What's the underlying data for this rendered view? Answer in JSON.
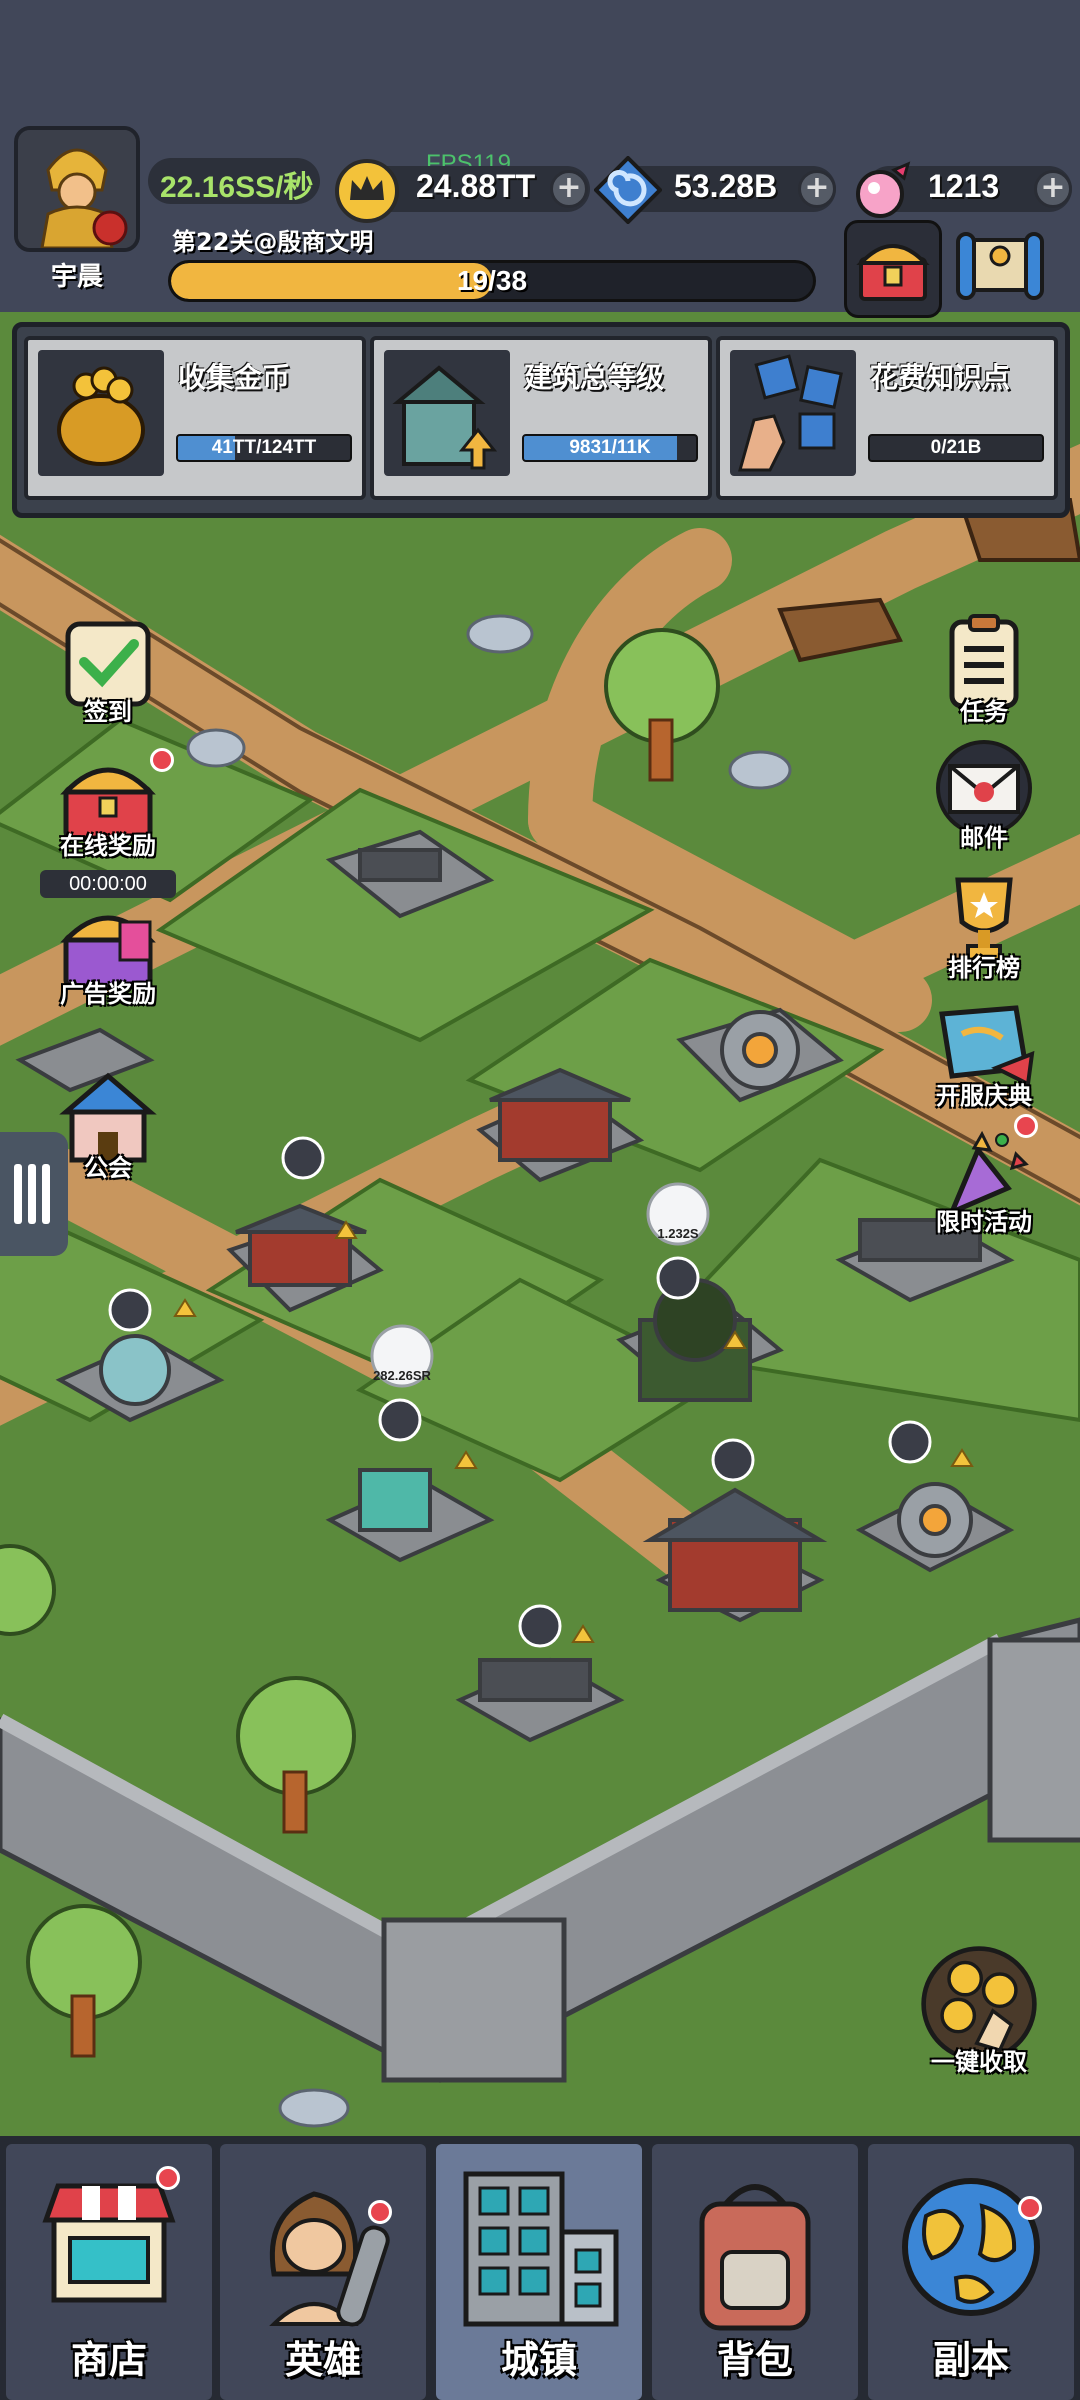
{
  "player": {
    "name": "宇晨"
  },
  "stats": {
    "gold_rate": "22.16SS/秒",
    "fps": "FPS119",
    "gold": "24.88TT",
    "knowledge": "53.28B",
    "gems": "1213"
  },
  "level": {
    "name": "第22关@殷商文明",
    "progress_text": "19/38",
    "progress": 0.5
  },
  "quests": [
    {
      "title": "收集金币",
      "progress_text": "41TT/124TT",
      "progress": 0.33
    },
    {
      "title": "建筑总等级",
      "progress_text": "9831/11K",
      "progress": 0.89
    },
    {
      "title": "花费知识点",
      "progress_text": "0/21B",
      "progress": 0.0
    }
  ],
  "left_menu": {
    "checkin": "签到",
    "online_reward": "在线奖励",
    "timer": "00:00:00",
    "ad_reward": "广告奖励",
    "guild": "公会"
  },
  "right_menu": {
    "tasks": "任务",
    "mail": "邮件",
    "rank": "排行榜",
    "celebration": "开服庆典",
    "limited_event": "限时活动",
    "collect_all": "一键收取"
  },
  "map_labels": {
    "bubble_1": "1.232S",
    "bubble_2": "282.26SR"
  },
  "nav": {
    "shop": "商店",
    "heroes": "英雄",
    "town": "城镇",
    "bag": "背包",
    "dungeon": "副本"
  },
  "colors": {
    "grass": "#5b8a3c",
    "road": "#c8965e",
    "accent": "#f1b640",
    "panel": "#414759"
  }
}
